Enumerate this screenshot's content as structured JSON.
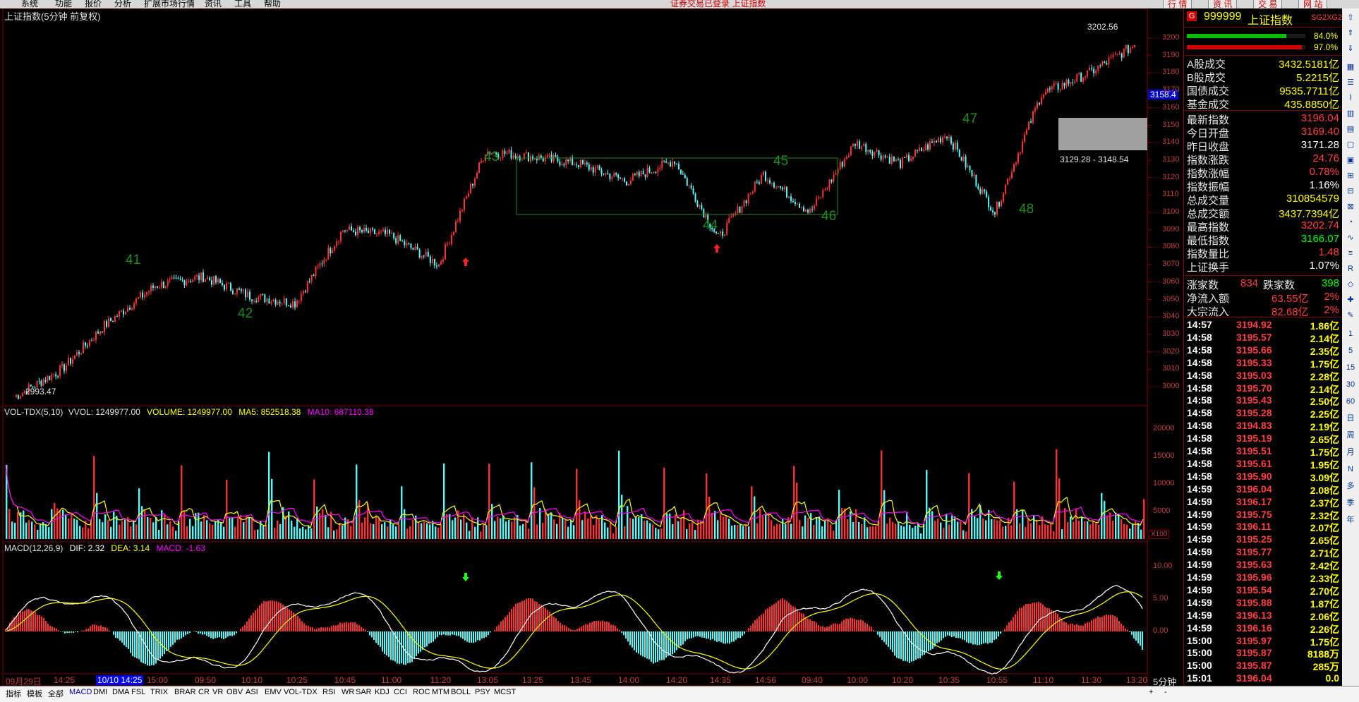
{
  "menu": {
    "items": [
      "系统",
      "功能",
      "报价",
      "分析",
      "扩展市场行情",
      "资讯",
      "工具",
      "帮助"
    ],
    "center": "证券交易已登录  上证指数",
    "right_buttons": [
      "行 情",
      "资 讯",
      "交 易",
      "网 站"
    ]
  },
  "chart": {
    "title": "上证指数(5分钟 前复权)",
    "price_axis": [
      "3200",
      "3190",
      "3180",
      "3170",
      "3160",
      "3150",
      "3140",
      "3130",
      "3120",
      "3110",
      "3100",
      "3090",
      "3080",
      "3070",
      "3060",
      "3050",
      "3040",
      "3030",
      "3020",
      "3010",
      "3000"
    ],
    "current_price_tag": "3158.4",
    "high_label": "3202.56",
    "low_label": "2993.47",
    "range_label": "3129.28 - 3148.54",
    "wave_labels": [
      "41",
      "42",
      "43",
      "44",
      "45",
      "46",
      "47",
      "48"
    ],
    "vol_header": {
      "name": "VOL-TDX(5,10)",
      "vvol": "VVOL: 1249977.00",
      "volume": "VOLUME: 1249977.00",
      "ma5": "MA5: 852518.38",
      "ma10": "MA10: 687110.38"
    },
    "vol_axis": [
      "20000",
      "15000",
      "10000",
      "5000"
    ],
    "vol_unit": "X100",
    "macd_header": {
      "name": "MACD(12,26,9)",
      "dif": "DIF: 2.32",
      "dea": "DEA: 3.14",
      "macd": "MACD: -1.63"
    },
    "macd_axis": [
      "10.00",
      "5.00",
      "0.00"
    ],
    "time_axis": [
      "09月29日",
      "14:25",
      "10/10 14:25",
      "15:00",
      "09:50",
      "10:10",
      "10:25",
      "10:45",
      "11:00",
      "11:20",
      "13:05",
      "13:25",
      "13:45",
      "14:00",
      "14:20",
      "14:35",
      "14:56",
      "09:40",
      "10:00",
      "10:20",
      "10:35",
      "10:55",
      "11:10",
      "11:30",
      "13:20"
    ],
    "period": "5分钟",
    "colors": {
      "up": "#ff3232",
      "down": "#54fcfc",
      "label": "#1e8c1e",
      "ma5": "#ffff00",
      "ma10": "#ff00ff"
    }
  },
  "chart_data": {
    "type": "line",
    "title": "上证指数(5分钟 前复权)",
    "ylim": [
      2990,
      3205
    ],
    "x": [
      "09月29日",
      "14:25",
      "10/10 14:25",
      "15:00",
      "09:50",
      "10:10",
      "10:25",
      "10:45",
      "11:00",
      "11:20",
      "13:05",
      "13:25",
      "13:45",
      "14:00",
      "14:20",
      "14:35",
      "14:56",
      "09:40",
      "10:00",
      "10:20",
      "10:35",
      "10:55",
      "11:10",
      "11:30",
      "13:20"
    ],
    "series": [
      {
        "name": "上证指数",
        "values": [
          2994,
          3010,
          3035,
          3058,
          3063,
          3052,
          3048,
          3090,
          3087,
          3070,
          3135,
          3132,
          3128,
          3118,
          3130,
          3085,
          3122,
          3100,
          3140,
          3128,
          3145,
          3100,
          3168,
          3180,
          3196
        ]
      }
    ],
    "annotations": {
      "high": 3202.56,
      "low": 2993.47,
      "range": "3129.28 - 3148.54"
    }
  },
  "panel": {
    "code": "999999",
    "name": "上证指数",
    "tag": "SG2XG2",
    "bar1_pct": "84.0%",
    "bar2_pct": "97.0%",
    "bar1_level": 0.84,
    "bar2_level": 0.97,
    "turnover": [
      {
        "label": "A股成交",
        "value": "3432.5181亿"
      },
      {
        "label": "B股成交",
        "value": "5.2215亿"
      },
      {
        "label": "国债成交",
        "value": "9535.7711亿"
      },
      {
        "label": "基金成交",
        "value": "435.8850亿"
      }
    ],
    "stats": [
      {
        "label": "最新指数",
        "value": "3196.04",
        "color": "#ff4040"
      },
      {
        "label": "今日开盘",
        "value": "3169.40",
        "color": "#ff4040"
      },
      {
        "label": "昨日收盘",
        "value": "3171.28",
        "color": "#ffffff"
      },
      {
        "label": "指数涨跌",
        "value": "24.76",
        "color": "#ff4040"
      },
      {
        "label": "指数涨幅",
        "value": "0.78%",
        "color": "#ff4040"
      },
      {
        "label": "指数振幅",
        "value": "1.16%",
        "color": "#ffffff"
      },
      {
        "label": "总成交量",
        "value": "310854579",
        "color": "#ffff00"
      },
      {
        "label": "总成交额",
        "value": "3437.7394亿",
        "color": "#ffff00"
      },
      {
        "label": "最高指数",
        "value": "3202.74",
        "color": "#ff4040"
      },
      {
        "label": "最低指数",
        "value": "3166.07",
        "color": "#00ff00"
      },
      {
        "label": "指数量比",
        "value": "1.48",
        "color": "#ff4040"
      },
      {
        "label": "上证换手",
        "value": "1.07%",
        "color": "#ffffff"
      }
    ],
    "breadth": {
      "up_label": "涨家数",
      "up": "834",
      "down_label": "跌家数",
      "down": "398"
    },
    "flow": [
      {
        "label": "净流入额",
        "value": "63.55亿",
        "pct": "2%"
      },
      {
        "label": "大宗流入",
        "value": "82.68亿",
        "pct": "2%"
      }
    ],
    "ticks": [
      {
        "t": "14:57",
        "p": "3194.92",
        "v": "1.86亿"
      },
      {
        "t": "14:58",
        "p": "3195.57",
        "v": "2.14亿"
      },
      {
        "t": "14:58",
        "p": "3195.66",
        "v": "2.35亿"
      },
      {
        "t": "14:58",
        "p": "3195.33",
        "v": "1.75亿"
      },
      {
        "t": "14:58",
        "p": "3195.03",
        "v": "2.28亿"
      },
      {
        "t": "14:58",
        "p": "3195.70",
        "v": "2.14亿"
      },
      {
        "t": "14:58",
        "p": "3195.43",
        "v": "2.50亿"
      },
      {
        "t": "14:58",
        "p": "3195.28",
        "v": "2.25亿"
      },
      {
        "t": "14:58",
        "p": "3194.83",
        "v": "2.19亿"
      },
      {
        "t": "14:58",
        "p": "3195.19",
        "v": "2.65亿"
      },
      {
        "t": "14:58",
        "p": "3195.51",
        "v": "1.75亿"
      },
      {
        "t": "14:58",
        "p": "3195.61",
        "v": "1.95亿"
      },
      {
        "t": "14:58",
        "p": "3195.90",
        "v": "3.09亿"
      },
      {
        "t": "14:59",
        "p": "3196.04",
        "v": "2.08亿"
      },
      {
        "t": "14:59",
        "p": "3196.17",
        "v": "2.37亿"
      },
      {
        "t": "14:59",
        "p": "3195.75",
        "v": "2.32亿"
      },
      {
        "t": "14:59",
        "p": "3196.11",
        "v": "2.07亿"
      },
      {
        "t": "14:59",
        "p": "3195.25",
        "v": "2.65亿"
      },
      {
        "t": "14:59",
        "p": "3195.77",
        "v": "2.71亿"
      },
      {
        "t": "14:59",
        "p": "3195.63",
        "v": "2.42亿"
      },
      {
        "t": "14:59",
        "p": "3195.96",
        "v": "2.33亿"
      },
      {
        "t": "14:59",
        "p": "3195.54",
        "v": "2.70亿"
      },
      {
        "t": "14:59",
        "p": "3195.88",
        "v": "1.87亿"
      },
      {
        "t": "14:59",
        "p": "3196.13",
        "v": "2.06亿"
      },
      {
        "t": "14:59",
        "p": "3196.16",
        "v": "2.26亿"
      },
      {
        "t": "15:00",
        "p": "3195.97",
        "v": "1.75亿"
      },
      {
        "t": "15:00",
        "p": "3195.87",
        "v": "8188万"
      },
      {
        "t": "15:00",
        "p": "3195.87",
        "v": "285万"
      },
      {
        "t": "15:01",
        "p": "3196.04",
        "v": "0.0"
      }
    ]
  },
  "toolbar": {
    "items": [
      "1",
      "5",
      "15",
      "30",
      "60",
      "日",
      "周",
      "月",
      "N",
      "多",
      "季",
      "年"
    ]
  },
  "bottom": {
    "items": [
      "指标",
      "模板",
      "全部",
      "MACD",
      "DMI",
      "DMA",
      "FSL",
      "TRIX",
      "BRAR",
      "CR",
      "VR",
      "OBV",
      "ASI",
      "EMV",
      "VOL-TDX",
      "RSI",
      "WR",
      "SAR",
      "KDJ",
      "CCI",
      "ROC",
      "MTM",
      "BOLL",
      "PSY",
      "MCST"
    ],
    "right": [
      "+",
      "-"
    ]
  }
}
